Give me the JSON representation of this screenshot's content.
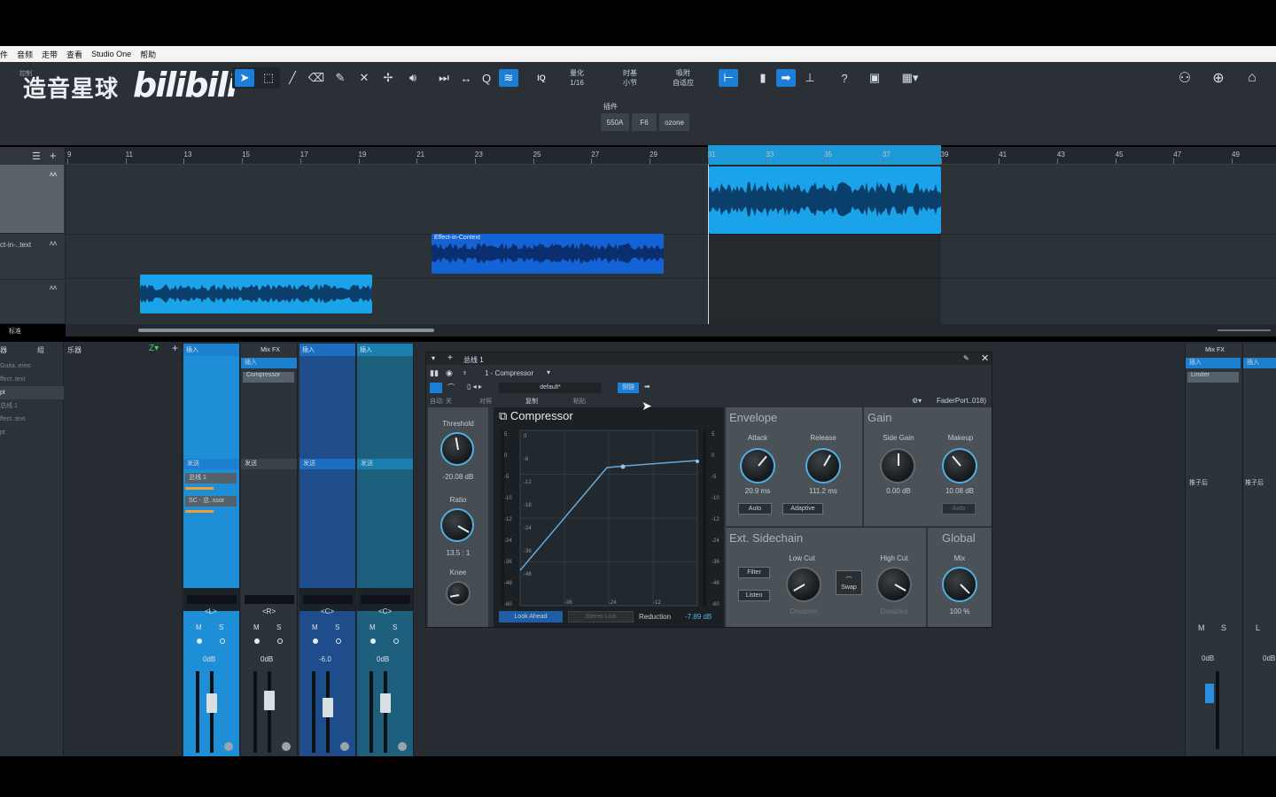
{
  "menu": [
    "件",
    "音频",
    "走带",
    "查看",
    "Studio One",
    "帮助"
  ],
  "logo": {
    "cn": "造音星球",
    "brand": "bilibili",
    "small_label": "控制"
  },
  "toolbar": {
    "quantize_label": "量化",
    "quantize_value": "1/16",
    "timebase_label": "时基",
    "timebase_value": "小节",
    "snap_label": "吸附",
    "snap_value": "自适应",
    "iq": "IQ",
    "plugins_label": "插件",
    "plugin_chips": [
      "550A",
      "F6",
      "ozone"
    ]
  },
  "ruler": [
    "9",
    "11",
    "13",
    "15",
    "17",
    "19",
    "21",
    "23",
    "25",
    "27",
    "29",
    "31",
    "33",
    "35",
    "37",
    "39",
    "41",
    "43",
    "45",
    "47",
    "49"
  ],
  "tracks": [
    {
      "name": ""
    },
    {
      "name": "ct-in-..text"
    },
    {
      "name": ""
    }
  ],
  "clips": {
    "effect_in_context": "Effect-in-Context"
  },
  "arrange_footer": {
    "left": "标准"
  },
  "browser": {
    "tabs": [
      "器",
      "组"
    ],
    "items": [
      "Guita..ereo",
      "ffect..text",
      "pt",
      "总线 1",
      "ffect..text",
      "pt"
    ]
  },
  "instrument_label": "乐器",
  "strips": [
    {
      "insert": "插入",
      "send": "发送",
      "send_items": [
        "总线 1",
        "SC - 总..ssor"
      ],
      "pan": "<L>",
      "volume": "0dB"
    },
    {
      "insert": "插入",
      "mixfx": "Mix FX",
      "insert_item": "Compressor",
      "send": "发送",
      "pan": "<R>",
      "volume": "0dB"
    },
    {
      "insert": "插入",
      "send": "发送",
      "pan": "<C>",
      "volume": "-6.0"
    },
    {
      "insert": "插入",
      "send": "发送",
      "pan": "<C>",
      "volume": "0dB"
    }
  ],
  "strip_buttons": {
    "m": "M",
    "s": "S"
  },
  "right_strips": [
    {
      "mixfx": "Mix FX",
      "insert": "插入",
      "insert_item": "Limiter",
      "post": "推子后",
      "volume": "0dB",
      "m": "M",
      "s": "S"
    },
    {
      "insert": "插入",
      "post": "推子后",
      "volume": "0dB",
      "l": "L"
    }
  ],
  "plugin": {
    "bus": "总线 1",
    "slot": "1 - Compressor",
    "preset": "default*",
    "auto": "自动: 关",
    "compare": "对照",
    "copy": "复制",
    "paste": "粘贴",
    "sidechain_btn": "侧链",
    "faderport": "FaderPort..018)",
    "title": "Compressor",
    "threshold": {
      "label": "Threshold",
      "value": "-20.08 dB"
    },
    "ratio": {
      "label": "Ratio",
      "value": "13.5 : 1"
    },
    "knee": {
      "label": "Knee"
    },
    "graph": {
      "left_ticks": [
        "0",
        "-6",
        "-12",
        "-18",
        "-24",
        "-36",
        "-48"
      ],
      "meter_ticks": [
        "5",
        "0",
        "-5",
        "-10",
        "-12",
        "-24",
        "-36",
        "-48",
        "-60"
      ],
      "bottom_ticks": [
        "-36",
        "-24",
        "-12"
      ]
    },
    "look_ahead": "Look Ahead",
    "stereo_link": "Stereo Link",
    "reduction_label": "Reduction",
    "reduction_value": "-7.89 dB",
    "envelope": {
      "title": "Envelope",
      "attack": "Attack",
      "attack_value": "20.9 ms",
      "release": "Release",
      "release_value": "111.2 ms",
      "auto": "Auto",
      "adaptive": "Adaptive"
    },
    "gain": {
      "title": "Gain",
      "side_gain": "Side Gain",
      "side_gain_value": "0.00 dB",
      "makeup": "Makeup",
      "makeup_value": "10.08 dB",
      "auto": "Auto"
    },
    "sidechain": {
      "title": "Ext. Sidechain",
      "filter": "Filter",
      "listen": "Listen",
      "low_cut": "Low Cut",
      "high_cut": "High Cut",
      "swap": "Swap",
      "disabled1": "Disabled",
      "disabled2": "Disabled"
    },
    "global": {
      "title": "Global",
      "mix": "Mix",
      "mix_value": "100 %"
    }
  },
  "colors": {
    "accent": "#1b7fd8",
    "clip_light": "#1aa3e8",
    "clip_dark": "#1463d6",
    "knob_ring": "#4fb0e0"
  }
}
